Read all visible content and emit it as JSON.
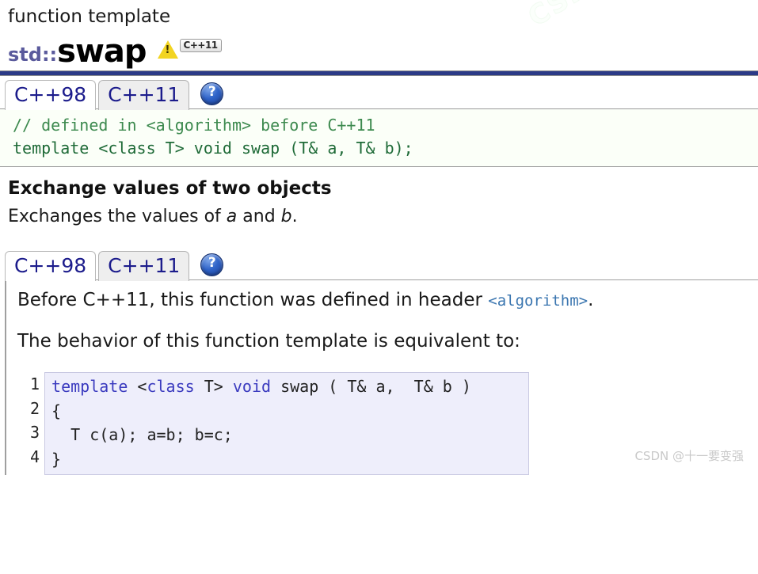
{
  "background_watermark": "CSDN",
  "header": {
    "kicker": "function template",
    "namespace": "std::",
    "name": "swap",
    "warning_icon": "warning-triangle-icon",
    "std_badge": "C++11"
  },
  "signature_section": {
    "tabs": [
      {
        "label": "C++98",
        "active": true
      },
      {
        "label": "C++11",
        "active": false
      }
    ],
    "help_icon": "help-question-icon",
    "code_lines": [
      "// defined in <algorithm> before C++11",
      "template <class T> void swap (T& a, T& b);"
    ]
  },
  "description": {
    "heading": "Exchange values of two objects",
    "text_prefix": "Exchanges the values of ",
    "var_a": "a",
    "text_middle": " and ",
    "var_b": "b",
    "text_suffix": "."
  },
  "detail_section": {
    "tabs": [
      {
        "label": "C++98",
        "active": true
      },
      {
        "label": "C++11",
        "active": false
      }
    ],
    "help_icon": "help-question-icon",
    "paragraph1_prefix": "Before C++11, this function was defined in header ",
    "paragraph1_code": "<algorithm>",
    "paragraph1_suffix": ".",
    "paragraph2": "The behavior of this function template is equivalent to:",
    "code_block": {
      "line_numbers": [
        "1",
        "2",
        "3",
        "4"
      ],
      "lines": [
        {
          "segments": [
            {
              "text": "template ",
              "kind": "kw"
            },
            {
              "text": "<",
              "kind": "plain"
            },
            {
              "text": "class",
              "kind": "kw"
            },
            {
              "text": " T> ",
              "kind": "plain"
            },
            {
              "text": "void",
              "kind": "kw"
            },
            {
              "text": " swap ( T& a,  T& b )",
              "kind": "plain"
            }
          ]
        },
        {
          "segments": [
            {
              "text": "{",
              "kind": "plain"
            }
          ]
        },
        {
          "segments": [
            {
              "text": "  T c(a); a=b; b=c;",
              "kind": "plain"
            }
          ]
        },
        {
          "segments": [
            {
              "text": "}",
              "kind": "plain"
            }
          ]
        }
      ]
    }
  },
  "footer": {
    "watermark": "CSDN @十一要变强"
  }
}
